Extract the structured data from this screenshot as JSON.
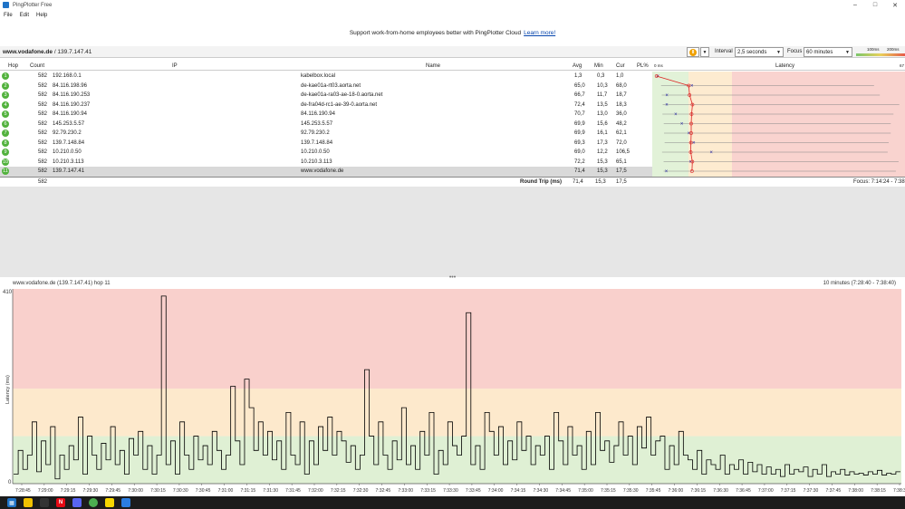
{
  "window": {
    "title": "PingPlotter Free"
  },
  "menu": [
    "File",
    "Edit",
    "Help"
  ],
  "banner": {
    "text": "Support work-from-home employees better with PingPlotter Cloud",
    "link": "Learn more!"
  },
  "toolbar": {
    "target_host": "www.vodafone.de",
    "target_ip": " / 139.7.147.41",
    "interval_label": "Interval",
    "interval_value": "2,5 seconds",
    "focus_label": "Focus",
    "focus_value": "60 minutes",
    "scale_low": "100ms",
    "scale_high": "200ms"
  },
  "table": {
    "headers": {
      "hop": "Hop",
      "count": "Count",
      "ip": "IP",
      "name": "Name",
      "avg": "Avg",
      "min": "Min",
      "cur": "Cur",
      "pl": "PL%",
      "latency": "Latency"
    },
    "latency_scale_left": "0 ms",
    "latency_scale_right": "67",
    "rows": [
      {
        "hop": "1",
        "count": "582",
        "ip": "192.168.0.1",
        "name": "kabelbox.local",
        "avg": "1,3",
        "min": "0,3",
        "cur": "1,0"
      },
      {
        "hop": "2",
        "count": "582",
        "ip": "84.116.198.96",
        "name": "de-kae01a-rt03.aorta.net",
        "avg": "65,0",
        "min": "10,3",
        "cur": "68,0"
      },
      {
        "hop": "3",
        "count": "582",
        "ip": "84.116.190.253",
        "name": "de-kae01a-ra03-ae-18-0.aorta.net",
        "avg": "66,7",
        "min": "11,7",
        "cur": "18,7"
      },
      {
        "hop": "4",
        "count": "582",
        "ip": "84.116.190.237",
        "name": "de-fra04d-rc1-ae-39-0.aorta.net",
        "avg": "72,4",
        "min": "13,5",
        "cur": "18,3"
      },
      {
        "hop": "5",
        "count": "582",
        "ip": "84.116.190.94",
        "name": "84.116.190.94",
        "avg": "70,7",
        "min": "13,0",
        "cur": "36,0"
      },
      {
        "hop": "6",
        "count": "582",
        "ip": "145.253.5.57",
        "name": "145.253.5.57",
        "avg": "69,9",
        "min": "15,6",
        "cur": "48,2"
      },
      {
        "hop": "7",
        "count": "582",
        "ip": "92.79.230.2",
        "name": "92.79.230.2",
        "avg": "69,9",
        "min": "16,1",
        "cur": "62,1"
      },
      {
        "hop": "8",
        "count": "582",
        "ip": "139.7.148.84",
        "name": "139.7.148.84",
        "avg": "69,3",
        "min": "17,3",
        "cur": "72,0"
      },
      {
        "hop": "9",
        "count": "582",
        "ip": "10.210.0.50",
        "name": "10.210.0.50",
        "avg": "69,0",
        "min": "12,2",
        "cur": "106,5"
      },
      {
        "hop": "10",
        "count": "582",
        "ip": "10.210.3.113",
        "name": "10.210.3.113",
        "avg": "72,2",
        "min": "15,3",
        "cur": "65,1"
      },
      {
        "hop": "11",
        "count": "582",
        "ip": "139.7.147.41",
        "name": "www.vodafone.de",
        "avg": "71,4",
        "min": "15,3",
        "cur": "17,5"
      }
    ],
    "summary": {
      "count": "582",
      "label": "Round Trip (ms)",
      "avg": "71,4",
      "min": "15,3",
      "cur": "17,5",
      "focus": "Focus: 7:14:24 - 7:38"
    }
  },
  "graph": {
    "title": "www.vodafone.de (139.7.147.41) hop 11",
    "range": "10 minutes (7:28:40 - 7:38:40)",
    "ylabel": "Latency (ms)",
    "ymax_label": "410",
    "ymin_label": "0"
  },
  "chart_data": {
    "type": "line",
    "title": "www.vodafone.de (139.7.147.41) hop 11",
    "xlabel": "",
    "ylabel": "Latency (ms)",
    "ylim": [
      0,
      410
    ],
    "x_ticks": [
      "7:28:45",
      "7:29:00",
      "7:29:15",
      "7:29:30",
      "7:29:45",
      "7:30:00",
      "7:30:15",
      "7:30:30",
      "7:30:45",
      "7:31:00",
      "7:31:15",
      "7:31:30",
      "7:31:45",
      "7:32:00",
      "7:32:15",
      "7:32:30",
      "7:32:45",
      "7:33:00",
      "7:33:15",
      "7:33:30",
      "7:33:45",
      "7:34:00",
      "7:34:15",
      "7:34:30",
      "7:34:45",
      "7:35:00",
      "7:35:15",
      "7:35:30",
      "7:35:45",
      "7:36:00",
      "7:36:15",
      "7:36:30",
      "7:36:45",
      "7:37:00",
      "7:37:15",
      "7:37:30",
      "7:37:45",
      "7:38:00",
      "7:38:15",
      "7:38:30"
    ],
    "zones": [
      {
        "from": 0,
        "to": 100,
        "color": "#dff0d4"
      },
      {
        "from": 100,
        "to": 200,
        "color": "#fde9cc"
      },
      {
        "from": 200,
        "to": 410,
        "color": "#f9d0cc"
      }
    ],
    "values": [
      20,
      70,
      30,
      60,
      130,
      25,
      90,
      40,
      120,
      10,
      60,
      30,
      80,
      50,
      140,
      20,
      100,
      60,
      30,
      85,
      50,
      120,
      40,
      70,
      20,
      95,
      60,
      110,
      30,
      80,
      20,
      60,
      395,
      40,
      90,
      20,
      130,
      60,
      30,
      100,
      50,
      80,
      40,
      110,
      70,
      30,
      60,
      205,
      90,
      40,
      220,
      160,
      70,
      130,
      60,
      110,
      50,
      90,
      30,
      150,
      60,
      40,
      130,
      20,
      90,
      40,
      120,
      70,
      140,
      60,
      110,
      90,
      45,
      80,
      30,
      60,
      240,
      100,
      40,
      130,
      60,
      30,
      90,
      50,
      160,
      40,
      80,
      30,
      110,
      60,
      150,
      20,
      70,
      40,
      130,
      80,
      60,
      100,
      360,
      40,
      80,
      30,
      150,
      110,
      60,
      120,
      40,
      90,
      50,
      130,
      70,
      100,
      40,
      80,
      60,
      100,
      30,
      150,
      90,
      40,
      120,
      60,
      80,
      30,
      110,
      40,
      150,
      70,
      90,
      45,
      80,
      130,
      60,
      100,
      40,
      120,
      75,
      140,
      60,
      90,
      100,
      30,
      80,
      40,
      110,
      60,
      50,
      30,
      70,
      20,
      50,
      40,
      30,
      60,
      20,
      40,
      30,
      50,
      20,
      45,
      25,
      40,
      20,
      35,
      20,
      30,
      15,
      40,
      20,
      30,
      25,
      35,
      15,
      30,
      20,
      40,
      15,
      25,
      20,
      30,
      18,
      25,
      20,
      22,
      18,
      25,
      20,
      28,
      18,
      22,
      20,
      25
    ]
  }
}
